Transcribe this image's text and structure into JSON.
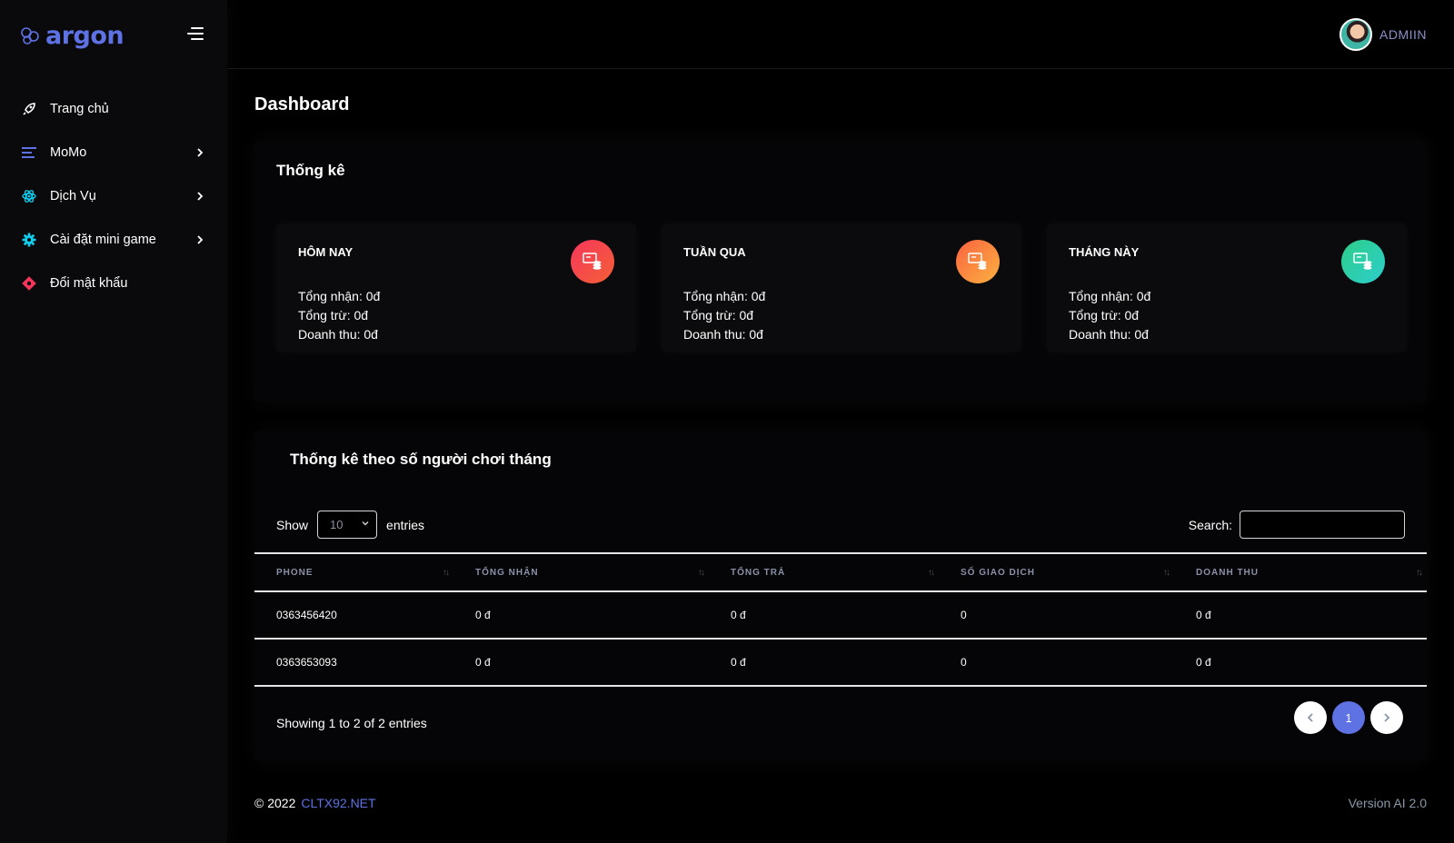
{
  "brand": {
    "name": "argon",
    "color": "#5e72e4",
    "icon": "argon-logo-icon"
  },
  "sidebar": {
    "items": [
      {
        "label": "Trang chủ",
        "icon": "rocket-icon",
        "has_submenu": false
      },
      {
        "label": "MoMo",
        "icon": "list-icon",
        "has_submenu": true
      },
      {
        "label": "Dịch Vụ",
        "icon": "atom-icon",
        "has_submenu": true
      },
      {
        "label": "Cài đặt mini game",
        "icon": "gear-icon",
        "has_submenu": true
      },
      {
        "label": "Đổi mật khẩu",
        "icon": "key-icon",
        "has_submenu": false
      }
    ]
  },
  "header": {
    "user_name": "ADMIIN"
  },
  "page_title": "Dashboard",
  "stats": {
    "title": "Thống kê",
    "cards": [
      {
        "title": "HÔM NAY",
        "received": "Tổng nhận: 0đ",
        "deducted": "Tổng trừ: 0đ",
        "revenue": "Doanh thu: 0đ",
        "icon": "money-coins-icon",
        "color": "#f5365c"
      },
      {
        "title": "TUẦN QUA",
        "received": "Tổng nhận: 0đ",
        "deducted": "Tổng trừ: 0đ",
        "revenue": "Doanh thu: 0đ",
        "icon": "money-coins-icon",
        "color": "#fb6340"
      },
      {
        "title": "THÁNG NÀY",
        "received": "Tổng nhận: 0đ",
        "deducted": "Tổng trừ: 0đ",
        "revenue": "Doanh thu: 0đ",
        "icon": "money-coins-icon",
        "color": "#2dce89"
      }
    ]
  },
  "player_table": {
    "title": "Thống kê theo số người chơi tháng",
    "show_label": "Show",
    "entries_label": "entries",
    "length_value": "10",
    "search_label": "Search:",
    "search_value": "",
    "columns": [
      "PHONE",
      "TỔNG NHẬN",
      "TỔNG TRẢ",
      "SỐ GIAO DỊCH",
      "DOANH THU"
    ],
    "rows": [
      [
        "0363456420",
        "0 đ",
        "0 đ",
        "0",
        "0 đ"
      ],
      [
        "0363653093",
        "0 đ",
        "0 đ",
        "0",
        "0 đ"
      ]
    ],
    "info": "Showing 1 to 2 of 2 entries",
    "pagination": {
      "prev": "‹",
      "current": "1",
      "next": "›"
    }
  },
  "footer": {
    "copyright": "© 2022",
    "link_text": "CLTX92.NET",
    "version": "Version AI 2.0"
  }
}
